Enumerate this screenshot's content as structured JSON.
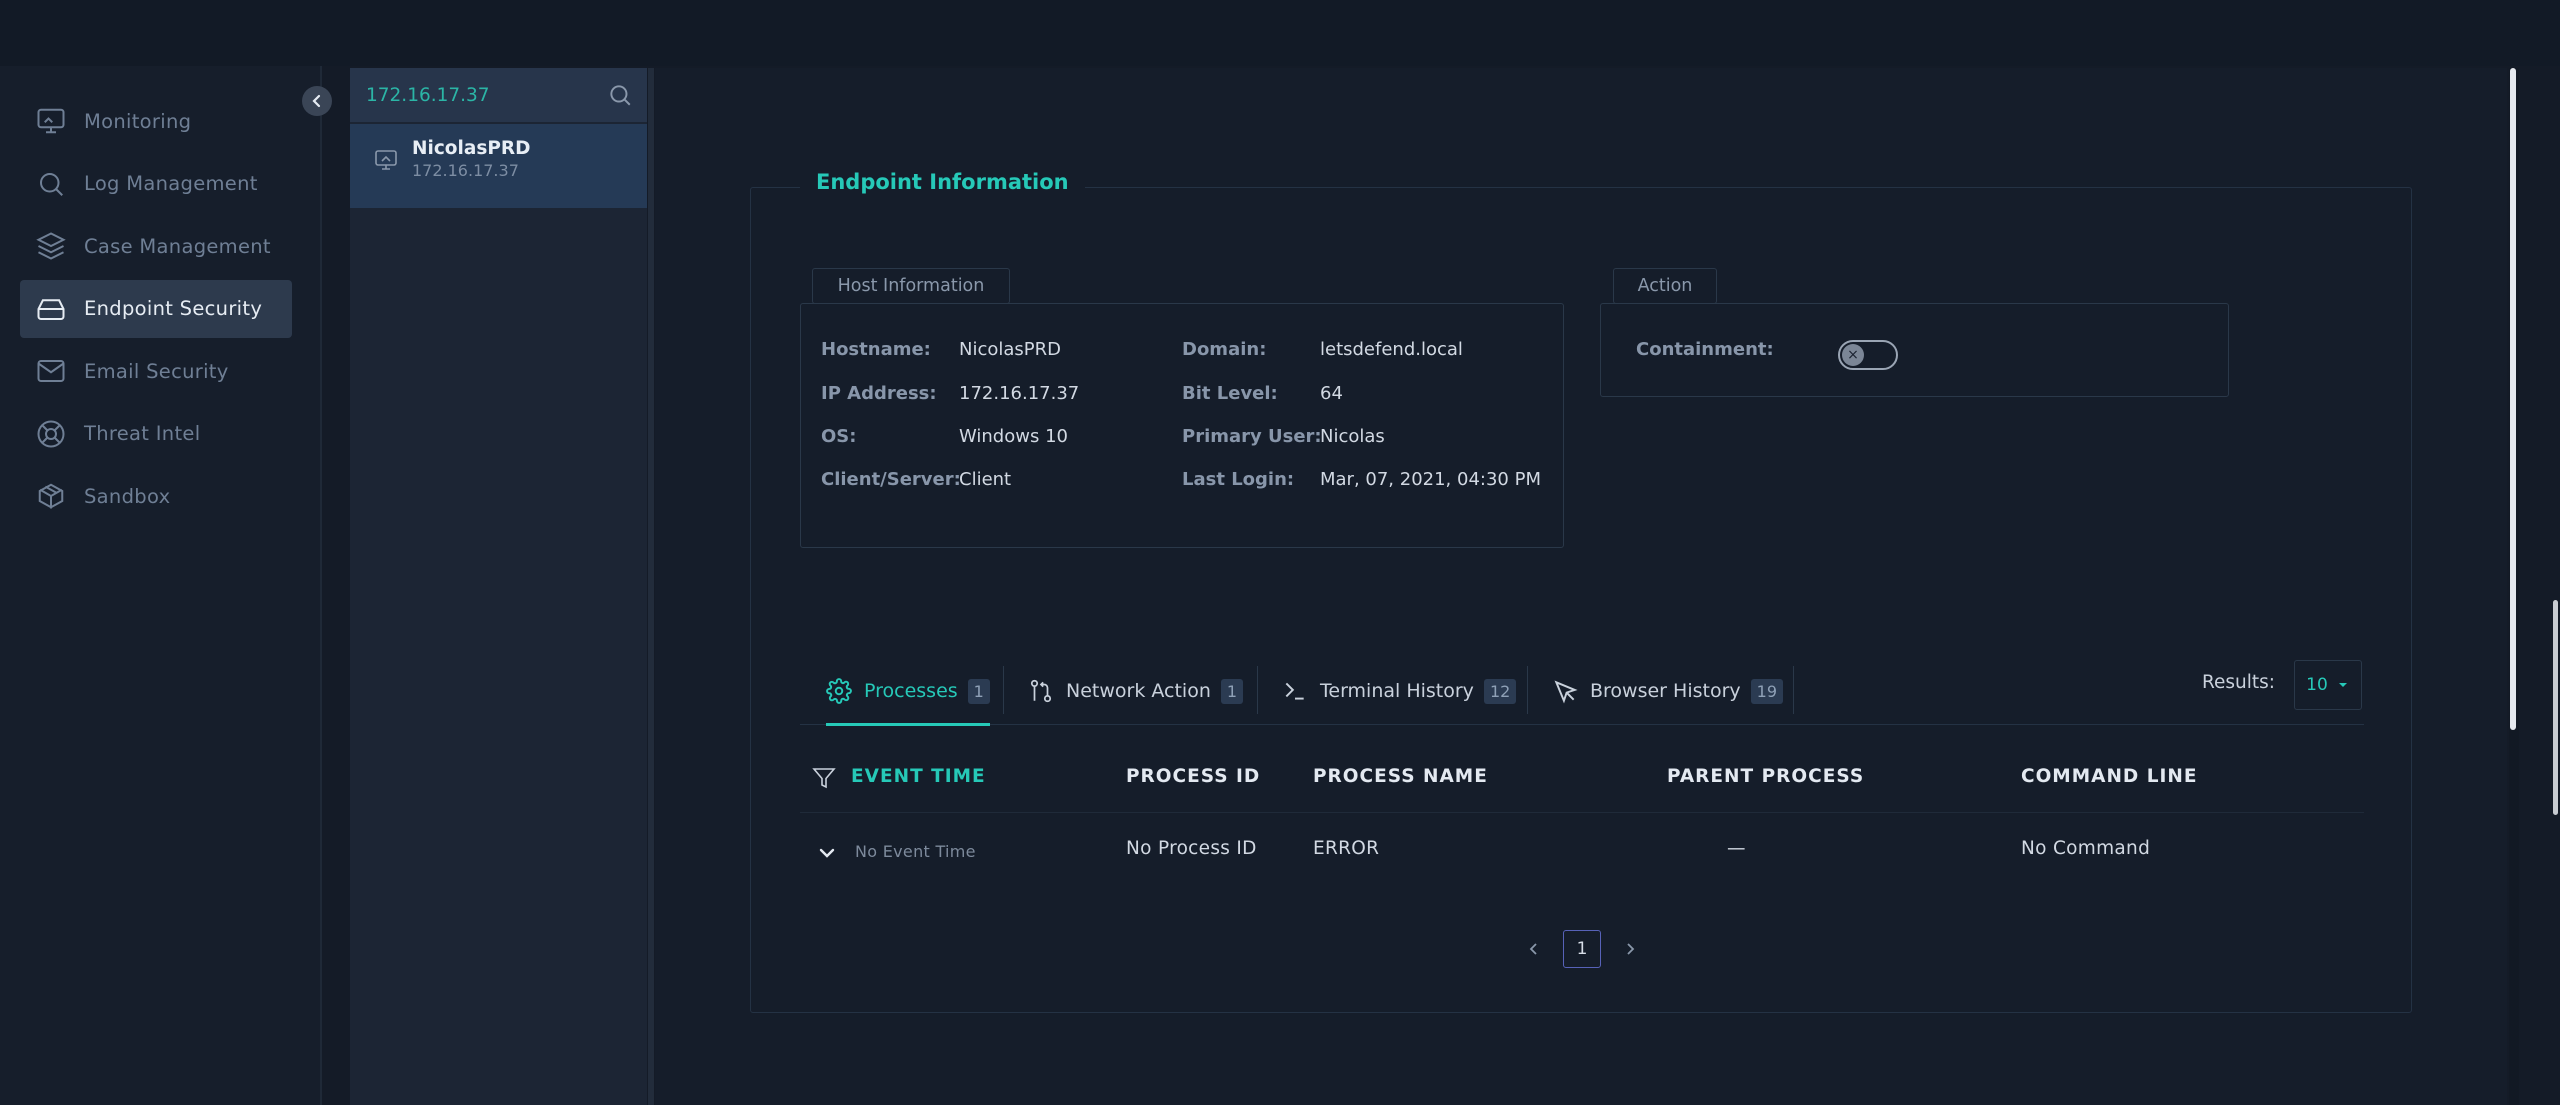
{
  "search": {
    "value": "172.16.17.37",
    "icon": "search-icon"
  },
  "nav": {
    "items": [
      {
        "label": "Monitoring",
        "icon": "monitor-icon"
      },
      {
        "label": "Log Management",
        "icon": "search-icon"
      },
      {
        "label": "Case Management",
        "icon": "layers-icon"
      },
      {
        "label": "Endpoint Security",
        "icon": "hard-drive-icon",
        "active": true
      },
      {
        "label": "Email Security",
        "icon": "mail-icon"
      },
      {
        "label": "Threat Intel",
        "icon": "life-buoy-icon"
      },
      {
        "label": "Sandbox",
        "icon": "box-icon"
      }
    ]
  },
  "host_list": [
    {
      "name": "NicolasPRD",
      "ip": "172.16.17.37"
    }
  ],
  "endpoint": {
    "title": "Endpoint Information",
    "host_info_label": "Host Information",
    "action_label": "Action",
    "fields": {
      "hostname_key": "Hostname:",
      "hostname": "NicolasPRD",
      "ip_key": "IP Address:",
      "ip": "172.16.17.37",
      "os_key": "OS:",
      "os": "Windows 10",
      "client_key": "Client/Server:",
      "client": "Client",
      "domain_key": "Domain:",
      "domain": "letsdefend.local",
      "bit_key": "Bit Level:",
      "bit": "64",
      "user_key": "Primary User:",
      "user": "Nicolas",
      "login_key": "Last Login:",
      "login": "Mar, 07, 2021, 04:30 PM"
    },
    "containment_label": "Containment:",
    "containment_enabled": false
  },
  "tabs": [
    {
      "label": "Processes",
      "count": "1",
      "icon": "gear-icon",
      "active": true
    },
    {
      "label": "Network Action",
      "count": "1",
      "icon": "git-pull-request-icon"
    },
    {
      "label": "Terminal History",
      "count": "12",
      "icon": "terminal-icon"
    },
    {
      "label": "Browser History",
      "count": "19",
      "icon": "cursor-icon"
    }
  ],
  "results": {
    "label": "Results:",
    "value": "10"
  },
  "table": {
    "headers": [
      "EVENT TIME",
      "PROCESS ID",
      "PROCESS NAME",
      "PARENT PROCESS",
      "COMMAND LINE"
    ],
    "rows": [
      [
        "No Event Time",
        "No Process ID",
        "ERROR",
        "—",
        "No Command"
      ]
    ]
  },
  "pagination": {
    "current": "1"
  },
  "colors": {
    "accent": "#26c9b8",
    "bg": "#141b27",
    "active_nav": "#2d3a4d"
  }
}
